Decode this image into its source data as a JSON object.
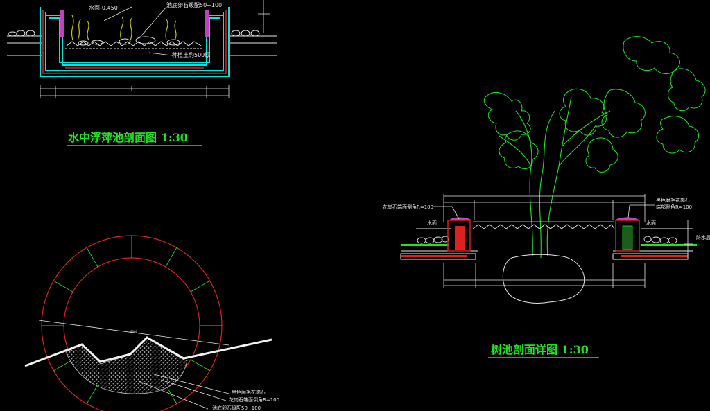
{
  "titles": {
    "pool": "水中浮萍池剖面图  1:30",
    "tree": "树池剖面详图  1:30"
  },
  "pool_labels": {
    "water_level": "水面-0.450",
    "bottom_stone": "池底卵石级配50~100",
    "planting_soil": "种植土約500厚"
  },
  "tree_labels": {
    "granite_edge": "花岗石端面倒角R=100",
    "granite_black": "黑色磨毛花岗石",
    "edge_chamfer": "端部倒角R=100",
    "water_left": "水面",
    "water_right": "水面",
    "waterproof": "防水层"
  },
  "circle_labels": {
    "granite_black": "黑色磨毛花岗石",
    "granite_edge": "花岗石端面倒角R=100",
    "bottom_stone": "池底卵石级配50~100",
    "dim": "9000"
  },
  "colors": {
    "background": "#000000",
    "cyan": "#00e5e5",
    "green": "#1ee61e",
    "red": "#e02020",
    "magenta": "#c040c0",
    "white": "#e6e6e6"
  }
}
